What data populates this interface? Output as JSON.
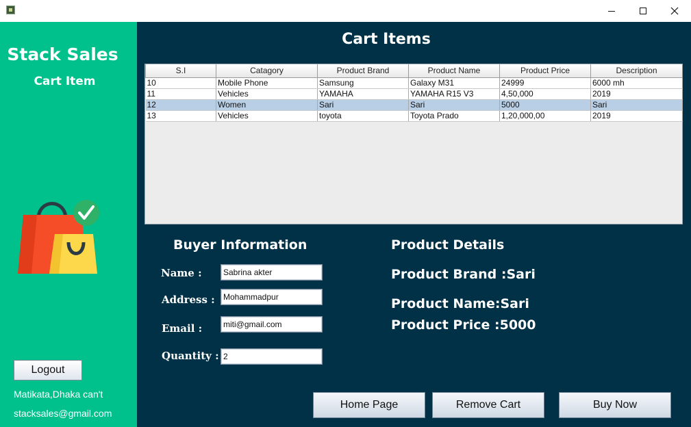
{
  "window": {
    "icon": "app-icon",
    "minimize_icon": "minimize-icon",
    "maximize_icon": "maximize-icon",
    "close_icon": "close-icon"
  },
  "sidebar": {
    "brand": "Stack Sales",
    "subtitle": "Cart Item",
    "illustration": "shopping-bags-icon",
    "logout_label": "Logout",
    "address": "Matikata,Dhaka can't",
    "email": "stacksales@gmail.com"
  },
  "main": {
    "title": "Cart Items",
    "table": {
      "headers": [
        "S.I",
        "Catagory",
        "Product Brand",
        "Product Name",
        "Product Price",
        "Description"
      ],
      "rows": [
        [
          "10",
          "Mobile Phone",
          "Samsung",
          "Galaxy M31",
          "24999",
          "6000 mh"
        ],
        [
          "11",
          "Vehicles",
          "YAMAHA",
          "YAMAHA R15 V3",
          "4,50,000",
          "2019"
        ],
        [
          "12",
          "Women",
          "Sari",
          "Sari",
          "5000",
          "Sari"
        ],
        [
          "13",
          "Vehicles",
          "toyota",
          "Toyota Prado",
          "1,20,000,00",
          "2019"
        ]
      ],
      "selected_row": 2
    },
    "buyer": {
      "heading": "Buyer Information",
      "name_label": "Name :",
      "name_value": "Sabrina akter",
      "address_label": "Address :",
      "address_value": "Mohammadpur",
      "email_label": "Email :",
      "email_value": "miti@gmail.com",
      "quantity_label": "Quantity :",
      "quantity_value": "2"
    },
    "product": {
      "heading": "Product Details",
      "brand": "Product Brand :Sari",
      "name": "Product Name:Sari",
      "price": "Product Price :5000"
    },
    "buttons": {
      "home": "Home Page",
      "remove": "Remove Cart",
      "buy": "Buy Now"
    }
  },
  "colors": {
    "sidebar": "#00c08b",
    "main": "#013146",
    "selected_row": "#b9cfe6"
  }
}
